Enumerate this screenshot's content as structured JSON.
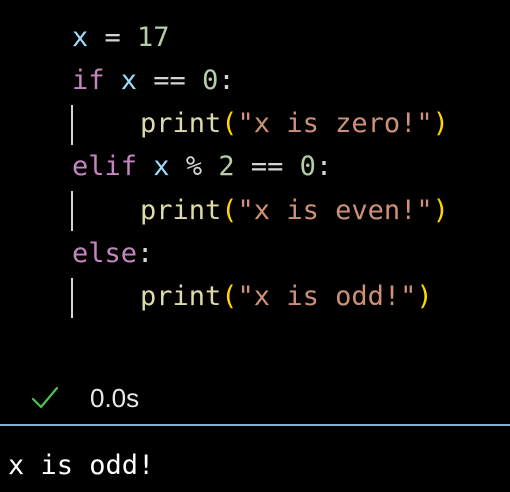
{
  "code": {
    "line1": {
      "var": "x",
      "op": " = ",
      "num": "17"
    },
    "line2": {
      "kw": "if",
      "sp1": " ",
      "var": "x",
      "op": " == ",
      "num": "0",
      "colon": ":"
    },
    "line3": {
      "fn": "print",
      "open": "(",
      "str": "\"x is zero!\"",
      "close": ")"
    },
    "line4": {
      "kw": "elif",
      "sp1": " ",
      "var": "x",
      "op1": " % ",
      "num1": "2",
      "op2": " == ",
      "num2": "0",
      "colon": ":"
    },
    "line5": {
      "fn": "print",
      "open": "(",
      "str": "\"x is even!\"",
      "close": ")"
    },
    "line6": {
      "kw": "else",
      "colon": ":"
    },
    "line7": {
      "fn": "print",
      "open": "(",
      "str": "\"x is odd!\"",
      "close": ")"
    }
  },
  "status": {
    "icon": "check-icon",
    "time": "0.0s",
    "color": "#4ec24e"
  },
  "output": {
    "text": "x is odd!"
  }
}
